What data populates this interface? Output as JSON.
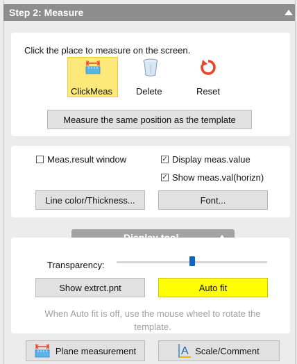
{
  "header": {
    "title": "Step 2: Measure",
    "collapse_icon": "triangle-up-icon"
  },
  "measure": {
    "instruction": "Click the place to measure on the screen.",
    "tools": [
      {
        "label": "ClickMeas",
        "icon": "ruler-icon",
        "selected": true
      },
      {
        "label": "Delete",
        "icon": "trash-icon",
        "selected": false
      },
      {
        "label": "Reset",
        "icon": "reset-icon",
        "selected": false
      }
    ],
    "same_position_label": "Measure the same position as the template"
  },
  "display_options": {
    "meas_result_window": {
      "label": "Meas.result window",
      "checked": false
    },
    "display_meas_value": {
      "label": "Display meas.value",
      "checked": true
    },
    "show_meas_val_horizn": {
      "label": "Show meas.val(horizn)",
      "checked": true
    },
    "line_color_label": "Line color/Thickness...",
    "font_label": "Font..."
  },
  "display_tool": {
    "title": "Display tool",
    "transparency_label": "Transparency:",
    "transparency_value": 0.5,
    "show_extrct_label": "Show extrct.pnt",
    "auto_fit_label": "Auto fit",
    "auto_fit_color": "#ffff00",
    "hint": "When Auto fit is off, use the mouse wheel to rotate the template."
  },
  "bottom": {
    "plane_measurement_label": "Plane measurement",
    "scale_comment_label": "Scale/Comment"
  },
  "colors": {
    "header_bg": "#8d8d8d",
    "selected_tool_bg": "#ffe87a",
    "slider_thumb": "#1565c0",
    "accent_red": "#e8442a"
  }
}
